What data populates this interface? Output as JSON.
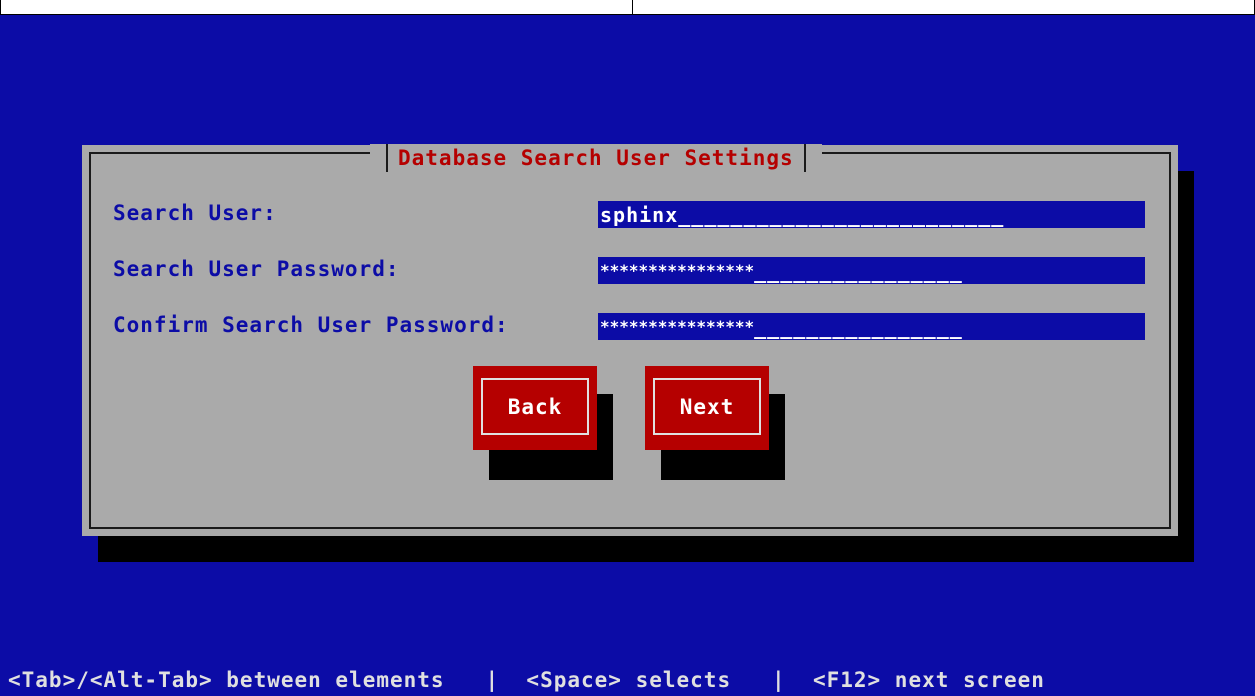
{
  "dialog": {
    "title": "Database Search User Settings"
  },
  "fields": [
    {
      "label": "Search User:",
      "value": "sphinx",
      "fill": "_________________________"
    },
    {
      "label": "Search User Password:",
      "value": "****************",
      "fill": "________________"
    },
    {
      "label": "Confirm Search User Password:",
      "value": "****************",
      "fill": "________________"
    }
  ],
  "buttons": {
    "back_label": "Back",
    "next_label": "Next"
  },
  "help": {
    "text": "<Tab>/<Alt-Tab> between elements   |  <Space> selects   |  <F12> next screen"
  },
  "colors": {
    "background": "#0c0ca6",
    "dialog": "#aaaaaa",
    "title": "#b50000",
    "button": "#b50000",
    "field": "#0c0ca6"
  }
}
